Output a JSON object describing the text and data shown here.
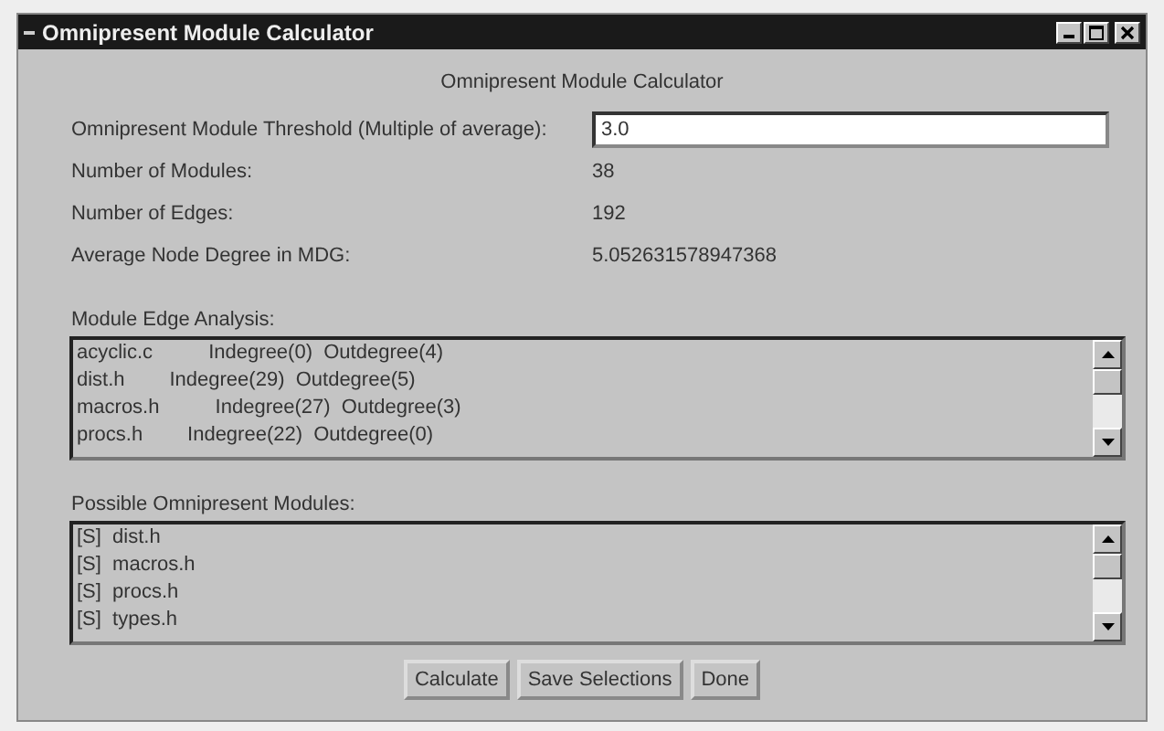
{
  "window": {
    "title": "Omnipresent Module Calculator"
  },
  "heading": "Omnipresent Module Calculator",
  "threshold": {
    "label": "Omnipresent Module Threshold (Multiple of average):",
    "value": "3.0"
  },
  "stats": [
    {
      "label": "Number of Modules:",
      "value": "38"
    },
    {
      "label": "Number of Edges:",
      "value": "192"
    },
    {
      "label": "Average Node Degree in MDG:",
      "value": "5.052631578947368"
    }
  ],
  "edge_analysis": {
    "label": "Module Edge Analysis:",
    "rows": [
      "acyclic.c          Indegree(0)  Outdegree(4)",
      "dist.h        Indegree(29)  Outdegree(5)",
      "macros.h          Indegree(27)  Outdegree(3)",
      "procs.h        Indegree(22)  Outdegree(0)"
    ]
  },
  "possible_modules": {
    "label": "Possible Omnipresent Modules:",
    "rows": [
      "[S]  dist.h",
      "[S]  macros.h",
      "[S]  procs.h",
      "[S]  types.h"
    ]
  },
  "buttons": [
    "Calculate",
    "Save Selections",
    "Done"
  ]
}
